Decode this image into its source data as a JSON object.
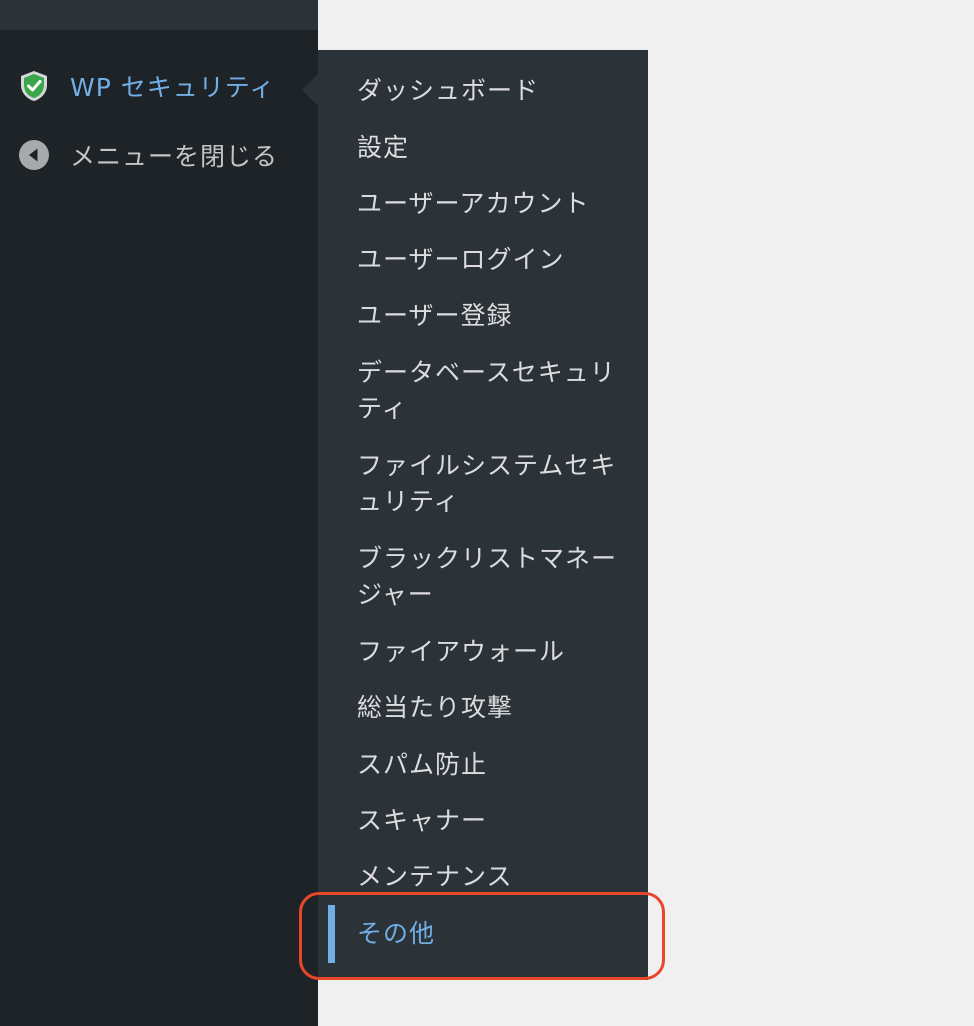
{
  "sidebar": {
    "wp_security_label": "WP セキュリティ",
    "collapse_label": "メニューを閉じる",
    "icons": [
      "shield-check-icon",
      "collapse-arrow-icon"
    ]
  },
  "submenu": {
    "items": [
      "ダッシュボード",
      "設定",
      "ユーザーアカウント",
      "ユーザーログイン",
      "ユーザー登録",
      "データベースセキュリティ",
      "ファイルシステムセキュリティ",
      "ブラックリストマネージャー",
      "ファイアウォール",
      "総当たり攻撃",
      "スパム防止",
      "スキャナー",
      "メンテナンス",
      "その他"
    ],
    "active_item": "その他"
  },
  "colors": {
    "sidebar_bg": "#1d2327",
    "submenu_bg": "#2c3338",
    "accent": "#72aee6",
    "highlight_border": "#e8472a"
  }
}
